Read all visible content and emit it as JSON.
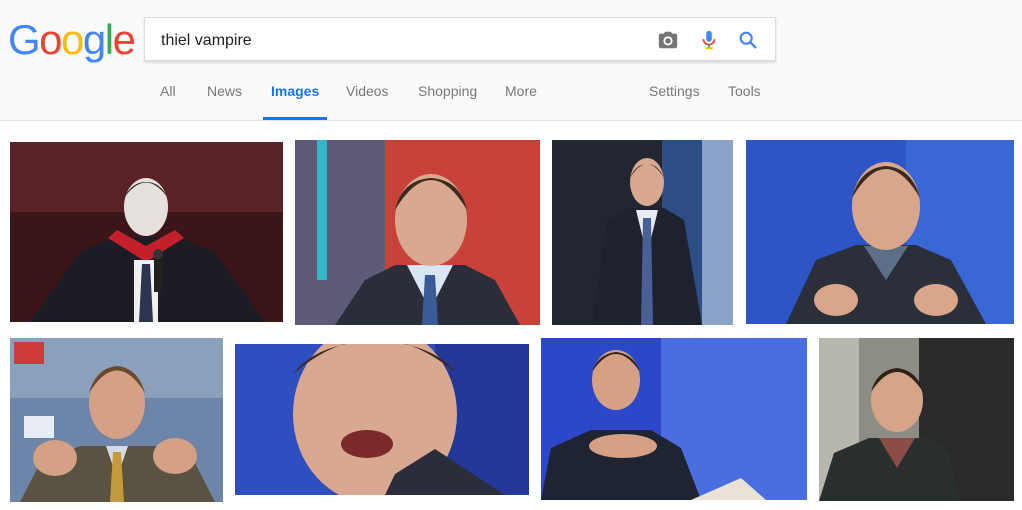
{
  "logo": {
    "letters": [
      "G",
      "o",
      "o",
      "g",
      "l",
      "e"
    ],
    "colors": [
      "#4285F4",
      "#EA4335",
      "#FBBC05",
      "#4285F4",
      "#34A853",
      "#EA4335"
    ]
  },
  "search": {
    "query": "thiel vampire",
    "icons": [
      "camera-icon",
      "microphone-icon",
      "search-icon"
    ]
  },
  "nav": {
    "tabs": [
      "All",
      "News",
      "Images",
      "Videos",
      "Shopping",
      "More"
    ],
    "active": "Images",
    "right": [
      "Settings",
      "Tools"
    ]
  },
  "results": {
    "count": 8,
    "accent": "#1a73e8"
  }
}
